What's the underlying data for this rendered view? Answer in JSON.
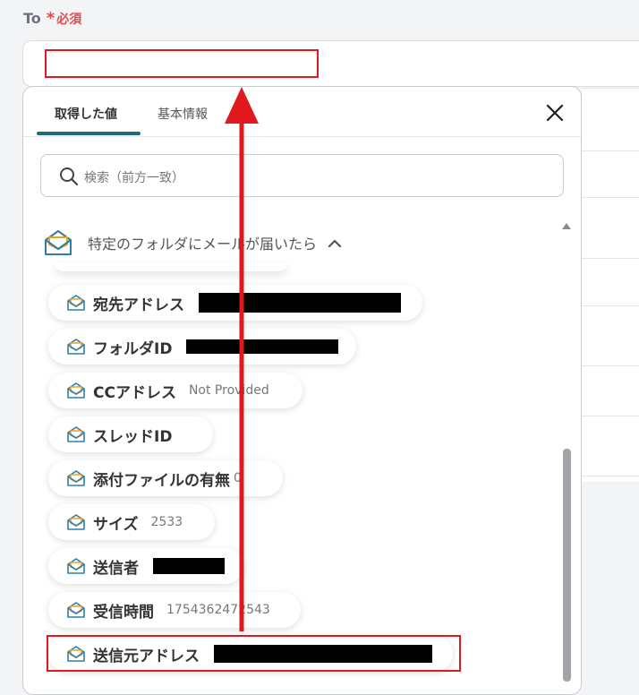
{
  "field": {
    "label": "To",
    "star": "*",
    "required": "必須",
    "value": ""
  },
  "popup": {
    "tabs": [
      {
        "label": "取得した値",
        "active": true
      },
      {
        "label": "基本情報",
        "active": false
      }
    ],
    "search_placeholder": "検索（前方一致）",
    "group_title": "特定のフォルダにメールが届いたら",
    "items": [
      {
        "label": "宛先アドレス",
        "value": "",
        "redacted": true
      },
      {
        "label": "フォルダID",
        "value": "",
        "redacted": true
      },
      {
        "label": "CCアドレス",
        "value": "Not Provided",
        "redacted": false
      },
      {
        "label": "スレッドID",
        "value": "",
        "redacted": false
      },
      {
        "label": "添付ファイルの有無",
        "value": "0",
        "redacted": false
      },
      {
        "label": "サイズ",
        "value": "2533",
        "redacted": false
      },
      {
        "label": "送信者",
        "value": "",
        "redacted": true
      },
      {
        "label": "受信時間",
        "value": "1754362472543",
        "redacted": false
      },
      {
        "label": "送信元アドレス",
        "value": "",
        "redacted": true
      }
    ]
  },
  "colors": {
    "accent_tab": "#1f6b7d",
    "highlight_red": "#e0191f",
    "required_red": "#e5484d"
  }
}
